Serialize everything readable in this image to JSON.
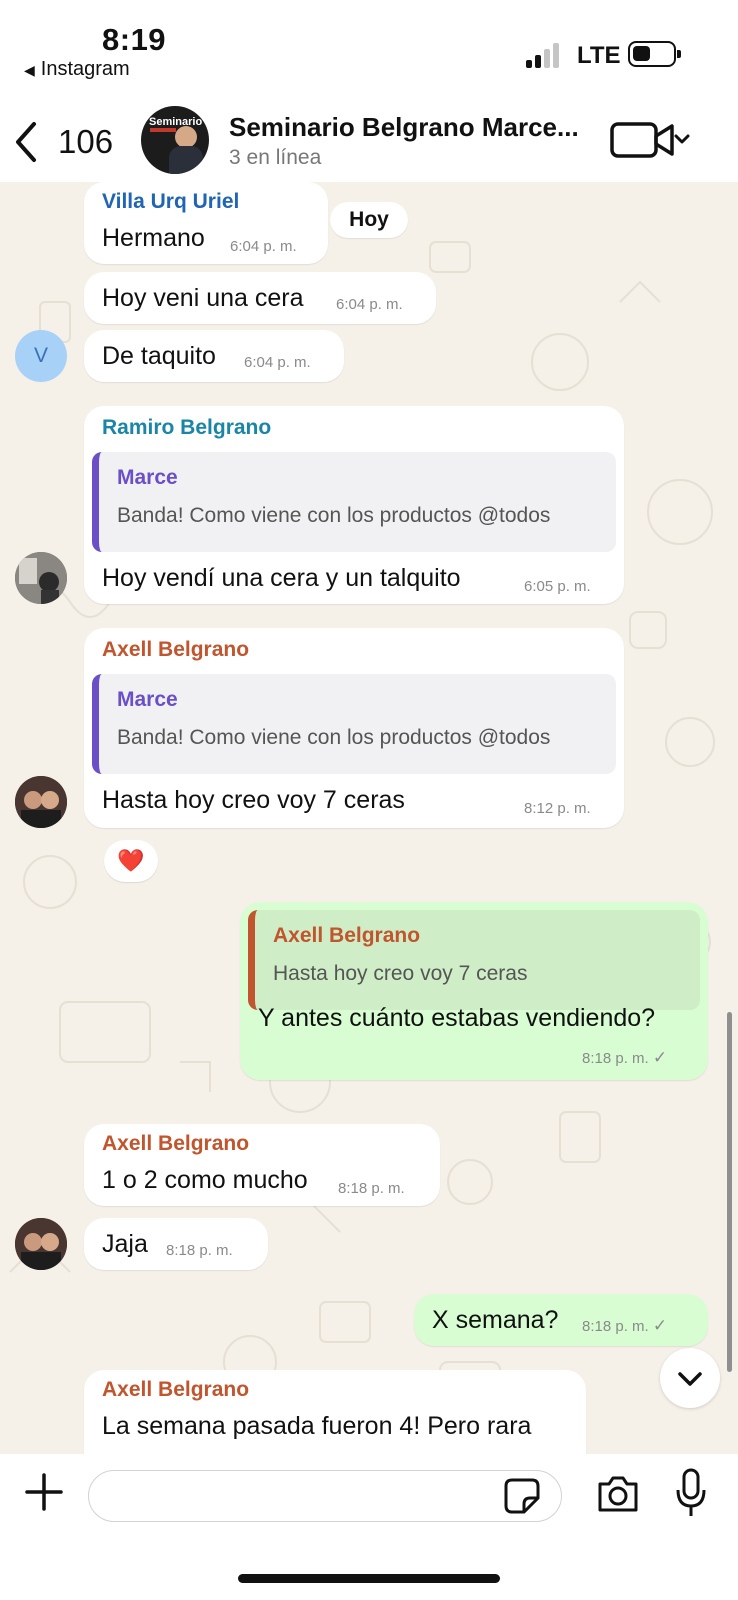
{
  "status_bar": {
    "time": "8:19",
    "back_app": "Instagram",
    "network": "LTE"
  },
  "header": {
    "back_count": "106",
    "title": "Seminario Belgrano Marce...",
    "subtitle": "3 en línea",
    "avatar_text": "Seminario"
  },
  "chat": {
    "day_label": "Hoy",
    "messages": [
      {
        "sender": "Villa Urq Uriel",
        "text": "Hermano",
        "time": "6:04 p. m."
      },
      {
        "text": "Hoy veni una cera",
        "time": "6:04 p. m."
      },
      {
        "text": "De taquito",
        "time": "6:04 p. m.",
        "avatar_letter": "V"
      },
      {
        "sender": "Ramiro Belgrano",
        "quote_name": "Marce",
        "quote_text": "Banda! Como viene con los productos @todos",
        "text": "Hoy vendí una cera y un talquito",
        "time": "6:05 p. m."
      },
      {
        "sender": "Axell Belgrano",
        "quote_name": "Marce",
        "quote_text": "Banda! Como viene con los productos @todos",
        "text": "Hasta hoy creo voy 7 ceras",
        "time": "8:12 p. m.",
        "reaction": "❤️"
      },
      {
        "outgoing": true,
        "quote_name": "Axell Belgrano",
        "quote_text": "Hasta hoy creo voy 7 ceras",
        "text": "Y antes cuánto estabas vendiendo?",
        "time": "8:18 p. m."
      },
      {
        "sender": "Axell Belgrano",
        "text": "1 o 2 como mucho",
        "time": "8:18 p. m."
      },
      {
        "text": "Jaja",
        "time": "8:18 p. m."
      },
      {
        "outgoing": true,
        "text": "X semana?",
        "time": "8:18 p. m."
      },
      {
        "sender": "Axell Belgrano",
        "text": "La semana pasada fueron 4! Pero rara"
      }
    ]
  },
  "composer": {
    "placeholder": ""
  },
  "colors": {
    "sender_blue": "#1f65b4",
    "sender_teal": "#1b85a8",
    "sender_orange": "#c0552e",
    "quote_purple": "#6a4fc9",
    "outgoing_bubble": "#d9fdd3",
    "incoming_bubble": "#ffffff"
  },
  "icons": [
    "back-chevron-icon",
    "video-call-icon",
    "chevron-down-icon",
    "plus-icon",
    "sticker-icon",
    "camera-icon",
    "microphone-icon",
    "check-icon"
  ]
}
